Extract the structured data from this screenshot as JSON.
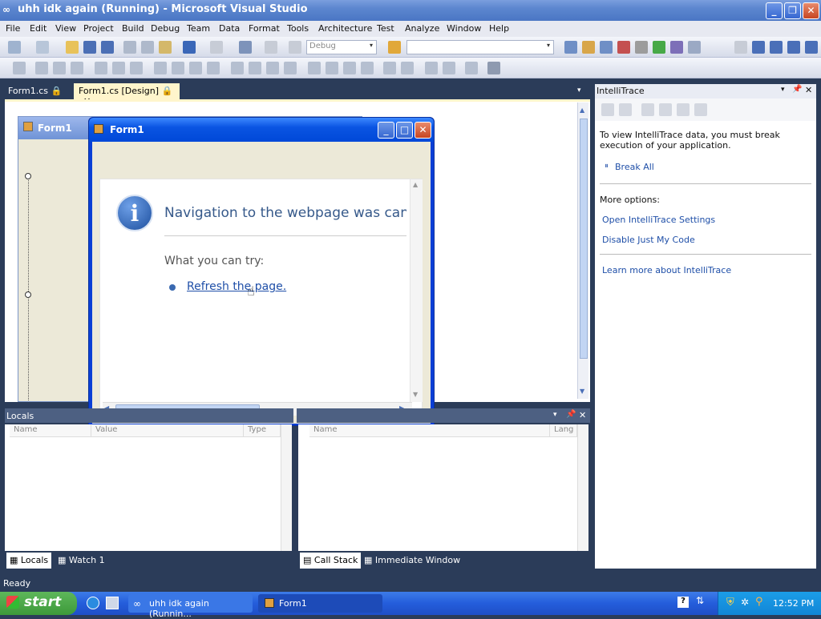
{
  "window": {
    "title": "uhh idk again (Running) - Microsoft Visual Studio"
  },
  "menu": [
    "File",
    "Edit",
    "View",
    "Project",
    "Build",
    "Debug",
    "Team",
    "Data",
    "Format",
    "Tools",
    "Architecture",
    "Test",
    "Analyze",
    "Window",
    "Help"
  ],
  "toolbar": {
    "config": "Debug",
    "platform": ""
  },
  "doc_tabs": [
    {
      "label": "Form1.cs"
    },
    {
      "label": "Form1.cs [Design]"
    }
  ],
  "designer": {
    "form_title": "Form1"
  },
  "running_form": {
    "title": "Form1",
    "browser": {
      "message": "Navigation to the webpage was canceled",
      "what_you_can_try": "What you can try:",
      "refresh_link": "Refresh the page."
    }
  },
  "intellitrace": {
    "title": "IntelliTrace",
    "description": "To view IntelliTrace data, you must break execution of your application.",
    "break_all": "Break All",
    "more_options": "More options:",
    "open_settings": "Open IntelliTrace Settings",
    "disable_jmc": "Disable Just My Code",
    "learn_more": "Learn more about IntelliTrace"
  },
  "locals": {
    "title": "Locals",
    "columns": [
      "Name",
      "Value",
      "Type"
    ]
  },
  "callstack": {
    "columns": [
      "Name",
      "Lang"
    ]
  },
  "bottom_tabs_left": [
    "Locals",
    "Watch 1"
  ],
  "bottom_tabs_right": [
    "Call Stack",
    "Immediate Window"
  ],
  "status": "Ready",
  "taskbar": {
    "start": "start",
    "tasks": [
      "uhh idk again (Runnin...",
      "Form1"
    ],
    "clock": "12:52 PM"
  }
}
